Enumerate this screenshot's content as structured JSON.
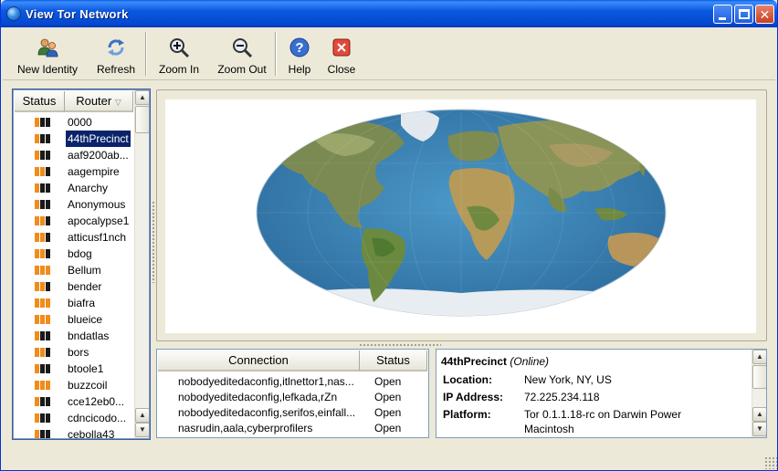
{
  "window": {
    "title": "View Tor Network"
  },
  "toolbar": {
    "new_identity": "New Identity",
    "refresh": "Refresh",
    "zoom_in": "Zoom In",
    "zoom_out": "Zoom Out",
    "help": "Help",
    "close": "Close"
  },
  "router_list": {
    "headers": {
      "status": "Status",
      "router": "Router"
    },
    "rows": [
      {
        "name": "0000",
        "bw": 1
      },
      {
        "name": "44thPrecinct",
        "bw": 1,
        "selected": true
      },
      {
        "name": "aaf9200ab...",
        "bw": 1
      },
      {
        "name": "aagempire",
        "bw": 2
      },
      {
        "name": "Anarchy",
        "bw": 1
      },
      {
        "name": "Anonymous",
        "bw": 1
      },
      {
        "name": "apocalypse1",
        "bw": 2
      },
      {
        "name": "atticusf1nch",
        "bw": 2
      },
      {
        "name": "bdog",
        "bw": 2
      },
      {
        "name": "Bellum",
        "bw": 3
      },
      {
        "name": "bender",
        "bw": 2
      },
      {
        "name": "biafra",
        "bw": 3
      },
      {
        "name": "blueice",
        "bw": 3
      },
      {
        "name": "bndatlas",
        "bw": 1
      },
      {
        "name": "bors",
        "bw": 2
      },
      {
        "name": "btoole1",
        "bw": 1
      },
      {
        "name": "buzzcoil",
        "bw": 3
      },
      {
        "name": "cce12eb0...",
        "bw": 1
      },
      {
        "name": "cdncicodo...",
        "bw": 1
      },
      {
        "name": "cebolla43",
        "bw": 1
      }
    ]
  },
  "connections": {
    "headers": {
      "connection": "Connection",
      "status": "Status"
    },
    "rows": [
      {
        "path": "nobodyeditedaconfig,itlnettor1,nas...",
        "status": "Open"
      },
      {
        "path": "nobodyeditedaconfig,lefkada,rZn",
        "status": "Open"
      },
      {
        "path": "nobodyeditedaconfig,serifos,einfall...",
        "status": "Open"
      },
      {
        "path": "nasrudin,aala,cyberprofilers",
        "status": "Open"
      }
    ]
  },
  "router_info": {
    "name": "44thPrecinct",
    "status": "(Online)",
    "location_label": "Location:",
    "location": "New York, NY, US",
    "ip_label": "IP Address:",
    "ip": "72.225.234.118",
    "platform_label": "Platform:",
    "platform_line1": "Tor 0.1.1.18-rc on Darwin Power",
    "platform_line2": "Macintosh"
  },
  "colors": {
    "bandwidth_on": "#f08c1a",
    "bandwidth_off": "#1a1a1a",
    "selection": "#0a246a",
    "ocean": "#3f86b8"
  }
}
